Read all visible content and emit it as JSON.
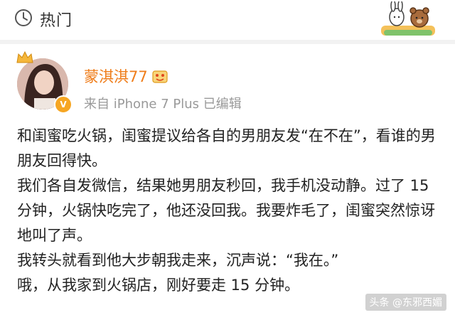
{
  "header": {
    "tab_label": "热门",
    "tab_icon": "hot-topic-icon",
    "sticker": "bunny-bear-sticker"
  },
  "post": {
    "username": "蒙淇淇77",
    "source_text": "来自 iPhone 7 Plus  已编辑",
    "badges": [
      "crown-icon",
      "verified-v-icon",
      "level-badge-icon"
    ],
    "paragraphs": [
      "和闺蜜吃火锅，闺蜜提议给各自的男朋友发“在不在”，看谁的男朋友回得快。",
      "我们各自发微信，结果她男朋友秒回，我手机没动静。过了 15 分钟，火锅快吃完了，他还没回我。我要炸毛了，闺蜜突然惊讶地叫了声。",
      "我转头就看到他大步朝我走来，沉声说：“我在。”",
      "哦，从我家到火锅店，刚好要走 15 分钟。"
    ]
  },
  "watermark": "头条 @东邪西媚",
  "colors": {
    "username": "#ef7d1a",
    "meta_text": "#999999",
    "body_text": "#222222",
    "verified_badge": "#f6a623"
  }
}
